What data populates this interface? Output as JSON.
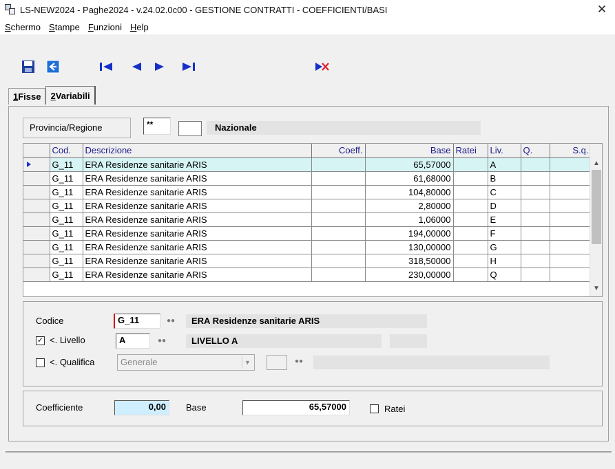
{
  "window": {
    "title": "LS-NEW2024 - Paghe2024 - v.24.02.0c00 - GESTIONE CONTRATTI - COEFFICIENTI/BASI",
    "close_label": "✕"
  },
  "menu": [
    {
      "u": "S",
      "rest": "chermo"
    },
    {
      "u": "S",
      "rest": "tampe"
    },
    {
      "u": "F",
      "rest": "unzioni"
    },
    {
      "u": "H",
      "rest": "elp"
    }
  ],
  "tabs": [
    {
      "u": "1",
      "rest": " Fisse"
    },
    {
      "u": "2",
      "rest": " Variabili"
    }
  ],
  "provincia": {
    "label": "Provincia/Regione",
    "code": "**",
    "sub": "",
    "name": "Nazionale"
  },
  "grid": {
    "headers": {
      "cod": "Cod.",
      "desc": "Descrizione",
      "coeff": "Coeff.",
      "base": "Base",
      "ratei": "Ratei",
      "liv": "Liv.",
      "q": "Q.",
      "sq": "S.q."
    },
    "rows": [
      {
        "cod": "G_11",
        "desc": "ERA Residenze sanitarie ARIS",
        "coeff": "",
        "base": "65,57000",
        "ratei": "",
        "liv": "A",
        "q": "",
        "sq": ""
      },
      {
        "cod": "G_11",
        "desc": "ERA Residenze sanitarie ARIS",
        "coeff": "",
        "base": "61,68000",
        "ratei": "",
        "liv": "B",
        "q": "",
        "sq": ""
      },
      {
        "cod": "G_11",
        "desc": "ERA Residenze sanitarie ARIS",
        "coeff": "",
        "base": "104,80000",
        "ratei": "",
        "liv": "C",
        "q": "",
        "sq": ""
      },
      {
        "cod": "G_11",
        "desc": "ERA Residenze sanitarie ARIS",
        "coeff": "",
        "base": "2,80000",
        "ratei": "",
        "liv": "D",
        "q": "",
        "sq": ""
      },
      {
        "cod": "G_11",
        "desc": "ERA Residenze sanitarie ARIS",
        "coeff": "",
        "base": "1,06000",
        "ratei": "",
        "liv": "E",
        "q": "",
        "sq": ""
      },
      {
        "cod": "G_11",
        "desc": "ERA Residenze sanitarie ARIS",
        "coeff": "",
        "base": "194,00000",
        "ratei": "",
        "liv": "F",
        "q": "",
        "sq": ""
      },
      {
        "cod": "G_11",
        "desc": "ERA Residenze sanitarie ARIS",
        "coeff": "",
        "base": "130,00000",
        "ratei": "",
        "liv": "G",
        "q": "",
        "sq": ""
      },
      {
        "cod": "G_11",
        "desc": "ERA Residenze sanitarie ARIS",
        "coeff": "",
        "base": "318,50000",
        "ratei": "",
        "liv": "H",
        "q": "",
        "sq": ""
      },
      {
        "cod": "G_11",
        "desc": "ERA Residenze sanitarie ARIS",
        "coeff": "",
        "base": "230,00000",
        "ratei": "",
        "liv": "Q",
        "q": "",
        "sq": ""
      }
    ]
  },
  "detail": {
    "codice_label": "Codice",
    "codice_value": "G_11",
    "codice_desc": "ERA Residenze sanitarie ARIS",
    "livello_label": "<. Livello",
    "livello_value": "A",
    "livello_desc": "LIVELLO  A",
    "qualifica_label": "<. Qualifica",
    "qualifica_value": "Generale"
  },
  "values": {
    "coeff_label": "Coefficiente",
    "coeff_value": "0,00",
    "base_label": "Base",
    "base_value": "65,57000",
    "ratei_label": "Ratei"
  },
  "colors": {
    "save": "#1f3f9a",
    "back": "#1e6fd6",
    "nav": "#1530c8",
    "delete_x": "#e0202a"
  }
}
